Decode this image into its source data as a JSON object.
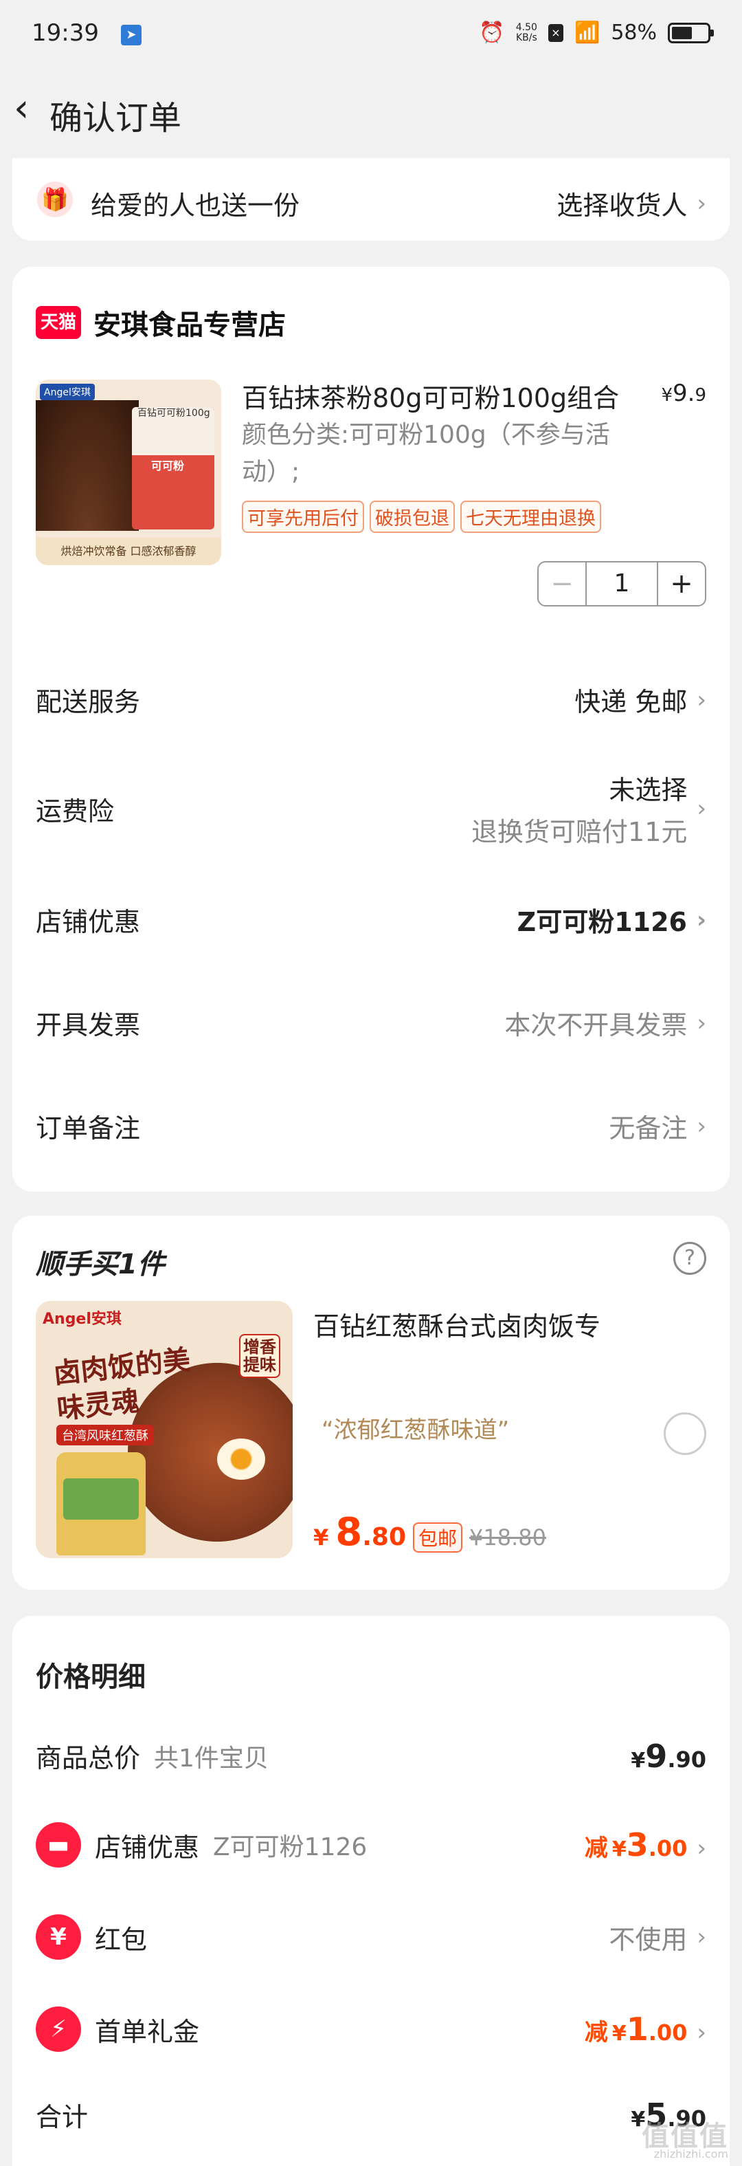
{
  "status": {
    "time": "19:39",
    "net_speed_value": "4.50",
    "net_speed_unit": "KB/s",
    "battery": "58%",
    "battery_level": 0.58
  },
  "header": {
    "title": "确认订单"
  },
  "gift": {
    "label": "给爱的人也送一份",
    "action": "选择收货人"
  },
  "store": {
    "platform_badge": "天猫",
    "name": "安琪食品专营店"
  },
  "product": {
    "title": "百钻抹茶粉80g可可粉100g组合",
    "price_symbol": "¥",
    "price_int": "9.",
    "price_dec": "9",
    "spec": "颜色分类:可可粉100g（不参与活动）;",
    "image_brand": "Angel安琪",
    "image_bag_title": "百钻可可粉100g",
    "image_bag_name": "可可粉",
    "image_caption": "烘焙冲饮常备 口感浓郁香醇",
    "tags": [
      "可享先用后付",
      "破损包退",
      "七天无理由退换"
    ],
    "qty": "1",
    "minus": "−",
    "plus": "+"
  },
  "rows": {
    "delivery_label": "配送服务",
    "delivery_value": "快递 免邮",
    "insurance_label": "运费险",
    "insurance_value_1": "未选择",
    "insurance_value_2": "退换货可赔付11元",
    "shop_discount_label": "店铺优惠",
    "shop_discount_value": "Z可可粉1126",
    "invoice_label": "开具发票",
    "invoice_value": "本次不开具发票",
    "note_label": "订单备注",
    "note_value": "无备注"
  },
  "addon": {
    "heading": "顺手买1件",
    "help": "?",
    "title": "百钻红葱酥台式卤肉饭专",
    "quote": "“浓郁红葱酥味道”",
    "image_brand": "Angel安琪",
    "image_slogan": "卤肉饭的美味灵魂",
    "image_flag": "台湾风味红葱酥",
    "image_seal": "增香提味",
    "price_symbol": "¥",
    "price_int": "8",
    "price_dec": ".80",
    "shipping_pill": "包邮",
    "original_price": "¥18.80"
  },
  "price_detail": {
    "heading": "价格明细",
    "total_label": "商品总价",
    "total_sub": "共1件宝贝",
    "total_symbol": "¥",
    "total_int": "9",
    "total_dec": ".90",
    "shop_label": "店铺优惠",
    "shop_sub": "Z可可粉1126",
    "shop_prefix": "减",
    "shop_symbol": "¥",
    "shop_int": "3",
    "shop_dec": ".00",
    "redpacket_label": "红包",
    "redpacket_value": "不使用",
    "firstorder_label": "首单礼金",
    "firstorder_prefix": "减",
    "firstorder_symbol": "¥",
    "firstorder_int": "1",
    "firstorder_dec": ".00",
    "sum_label": "合计",
    "sum_symbol": "¥",
    "sum_int": "5",
    "sum_dec": ".90"
  },
  "watermark": {
    "text": "值值值",
    "sub": "zhizhizhi.com"
  },
  "colors": {
    "accent": "#ff4a00",
    "tmall_red": "#ff0036",
    "page_bg": "#f1f1f1"
  },
  "icons": {
    "back": "chevron-left-icon",
    "gift": "gift-icon",
    "shop": "store-icon",
    "redpacket": "red-envelope-icon",
    "firstorder": "lightning-icon",
    "help": "question-circle-icon",
    "chevron": "chevron-right-icon"
  }
}
